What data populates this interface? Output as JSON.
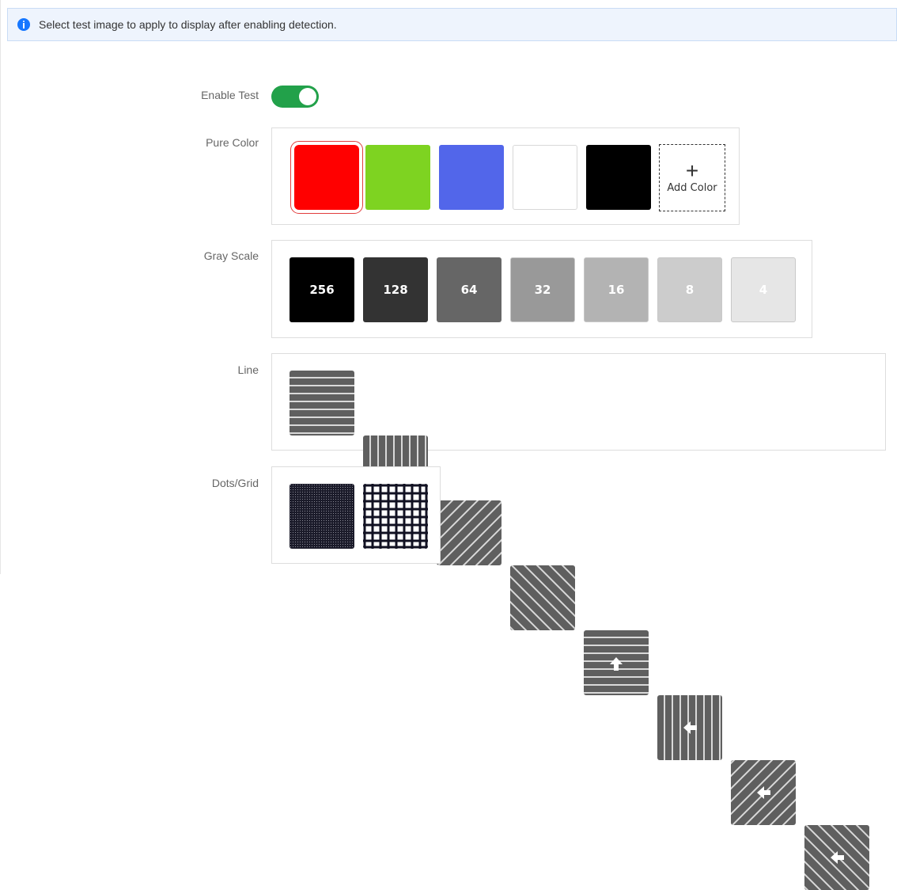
{
  "banner": {
    "text": "Select test image to apply to display after enabling detection."
  },
  "enable_test": {
    "label": "Enable Test",
    "on": true
  },
  "pure_color": {
    "label": "Pure Color",
    "colors": [
      "#ff0000",
      "#7ed321",
      "#5266ea",
      "#ffffff",
      "#000000"
    ],
    "selected_index": 0,
    "add_label": "Add Color"
  },
  "gray_scale": {
    "label": "Gray Scale",
    "items": [
      {
        "text": "256",
        "bg": "#000000",
        "fg": "#ffffff"
      },
      {
        "text": "128",
        "bg": "#333333",
        "fg": "#ffffff"
      },
      {
        "text": "64",
        "bg": "#666666",
        "fg": "#ffffff"
      },
      {
        "text": "32",
        "bg": "#999999",
        "fg": "#ffffff"
      },
      {
        "text": "16",
        "bg": "#b3b3b3",
        "fg": "#ffffff"
      },
      {
        "text": "8",
        "bg": "#cccccc",
        "fg": "#ffffff"
      },
      {
        "text": "4",
        "bg": "#e6e6e6",
        "fg": "#ffffff"
      }
    ]
  },
  "line": {
    "label": "Line",
    "patterns": [
      "horizontal",
      "vertical",
      "diagonal-up",
      "diagonal-down",
      "horizontal-arrow-up",
      "vertical-arrow-left",
      "diagonal-up-arrow-left",
      "diagonal-down-arrow-left"
    ]
  },
  "dots_grid": {
    "label": "Dots/Grid",
    "patterns": [
      "dots",
      "grid"
    ]
  }
}
